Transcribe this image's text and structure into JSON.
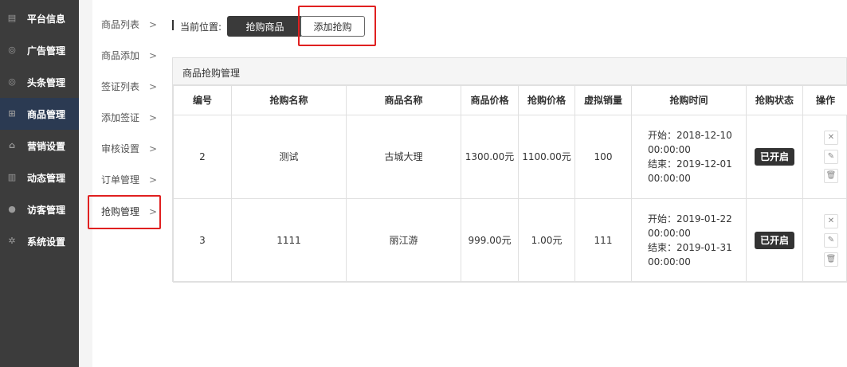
{
  "sidebar": {
    "items": [
      {
        "label": "平台信息",
        "icon": "newspaper-icon",
        "glyph": "▤",
        "active": false
      },
      {
        "label": "广告管理",
        "icon": "lifebuoy-icon",
        "glyph": "◎",
        "active": false
      },
      {
        "label": "头条管理",
        "icon": "lifebuoy-icon",
        "glyph": "◎",
        "active": false
      },
      {
        "label": "商品管理",
        "icon": "cart-icon",
        "glyph": "⊞",
        "active": true
      },
      {
        "label": "营销设置",
        "icon": "gift-icon",
        "glyph": "⌂",
        "active": false
      },
      {
        "label": "动态管理",
        "icon": "book-icon",
        "glyph": "▥",
        "active": false
      },
      {
        "label": "访客管理",
        "icon": "user-icon",
        "glyph": "●",
        "active": false
      },
      {
        "label": "系统设置",
        "icon": "gear-icon",
        "glyph": "✲",
        "active": false
      }
    ]
  },
  "subnav": {
    "items": [
      {
        "label": "商品列表"
      },
      {
        "label": "商品添加"
      },
      {
        "label": "签证列表"
      },
      {
        "label": "添加签证"
      },
      {
        "label": "审核设置"
      },
      {
        "label": "订单管理"
      },
      {
        "label": "抢购管理"
      }
    ],
    "chevron": ">"
  },
  "breadcrumb": {
    "label": "当前位置:",
    "current": "抢购商品"
  },
  "toolbar": {
    "add_label": "添加抢购"
  },
  "panel": {
    "title": "商品抢购管理"
  },
  "table": {
    "headers": [
      "编号",
      "抢购名称",
      "商品名称",
      "商品价格",
      "抢购价格",
      "虚拟销量",
      "抢购时间",
      "抢购状态",
      "操作"
    ],
    "rows": [
      {
        "id": "2",
        "name": "测试",
        "product": "古城大理",
        "price": "1300.00元",
        "sale_price": "1100.00元",
        "virtual_sales": "100",
        "start": "开始：2018-12-10 00:00:00",
        "end": "结束：2019-12-01 00:00:00",
        "status": "已开启"
      },
      {
        "id": "3",
        "name": "1111",
        "product": "丽江游",
        "price": "999.00元",
        "sale_price": "1.00元",
        "virtual_sales": "111",
        "start": "开始：2019-01-22 00:00:00",
        "end": "结束：2019-01-31 00:00:00",
        "status": "已开启"
      }
    ]
  },
  "ops": {
    "close": "✕",
    "edit": "✎",
    "delete": "🗑"
  },
  "colors": {
    "sidebar": "#3c3c3c",
    "active_nav": "#2b3a52",
    "highlight": "#e02020",
    "badge": "#333333"
  }
}
